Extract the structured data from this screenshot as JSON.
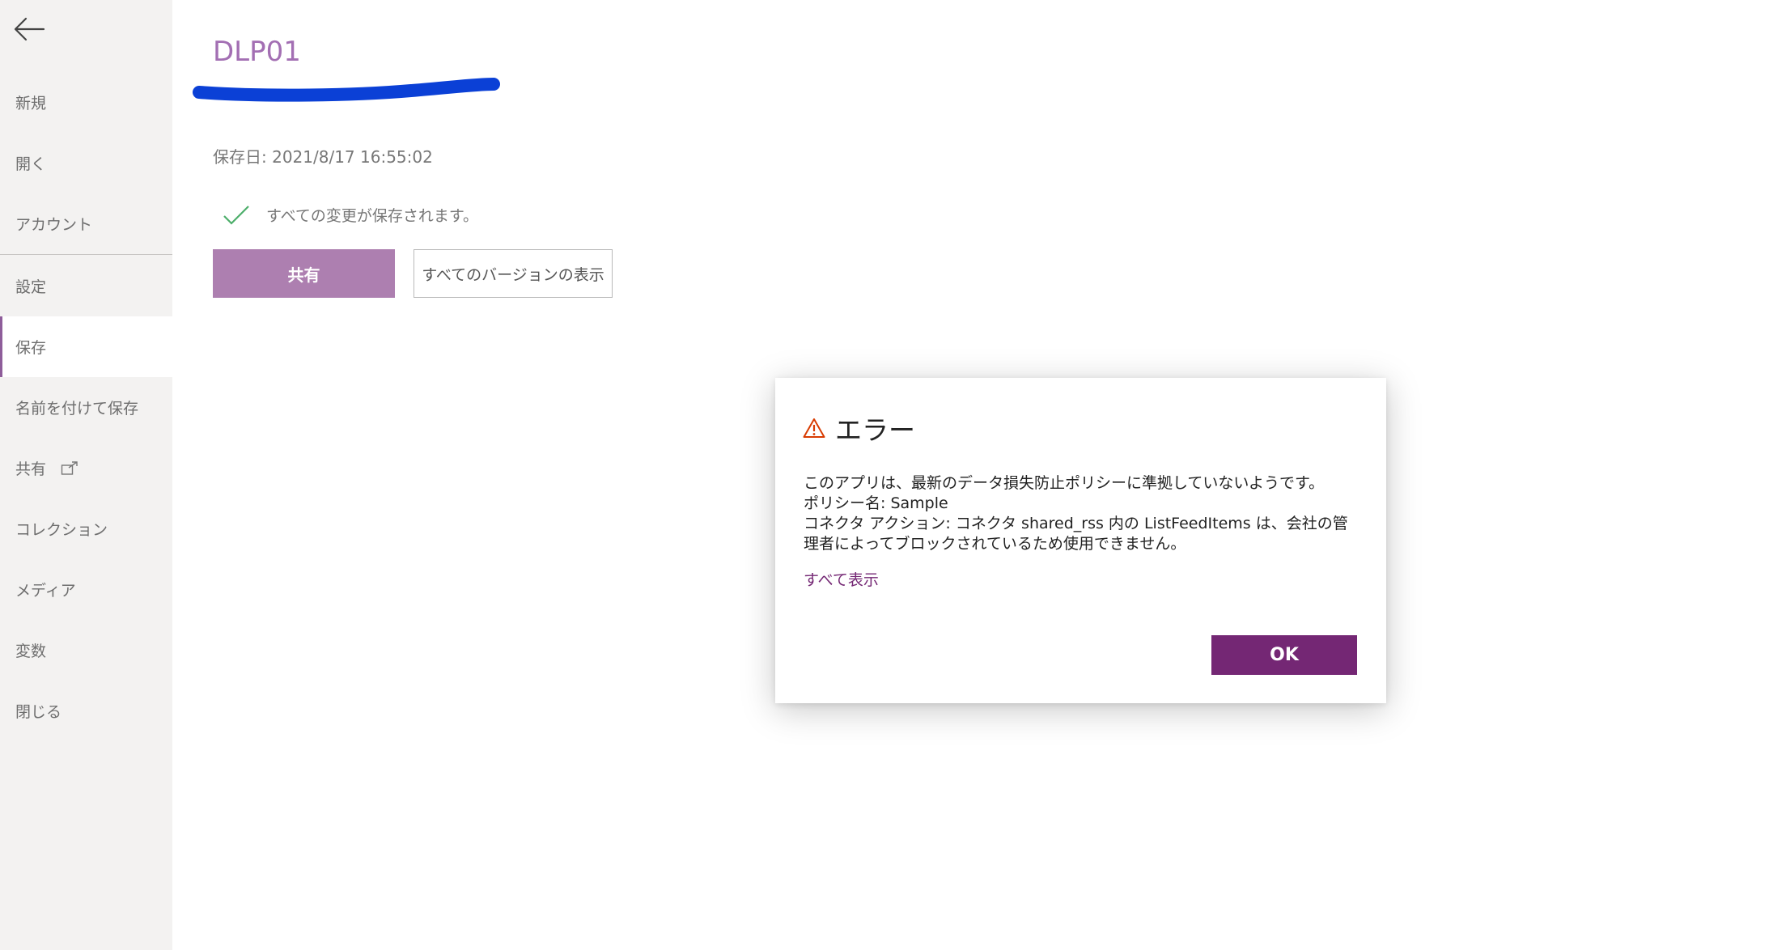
{
  "sidebar": {
    "items": [
      {
        "label": "新規"
      },
      {
        "label": "開く"
      },
      {
        "label": "アカウント"
      },
      {
        "label": "設定"
      },
      {
        "label": "保存"
      },
      {
        "label": "名前を付けて保存"
      },
      {
        "label": "共有"
      },
      {
        "label": "コレクション"
      },
      {
        "label": "メディア"
      },
      {
        "label": "変数"
      },
      {
        "label": "閉じる"
      }
    ],
    "active_item": "保存",
    "accent_color": "#8e5d9a"
  },
  "main": {
    "app_title": "DLP01",
    "saved_date": "保存日: 2021/8/17 16:55:02",
    "save_status": "すべての変更が保存されます。",
    "share_button": "共有",
    "versions_button": "すべてのバージョンの表示"
  },
  "dialog": {
    "title": "エラー",
    "line1": "このアプリは、最新のデータ損失防止ポリシーに準拠していないようです。",
    "line2": "ポリシー名: Sample",
    "line3": "コネクタ アクション: コネクタ shared_rss 内の ListFeedItems は、会社の管理者によってブロックされているため使用できません。",
    "show_all_link": "すべて表示",
    "ok_button": "OK",
    "primary_color": "#742774",
    "warning_color": "#d83b01"
  },
  "icons": {
    "back": "back-arrow-icon",
    "share_external": "external-share-icon",
    "check": "check-icon",
    "warning": "warning-icon"
  }
}
